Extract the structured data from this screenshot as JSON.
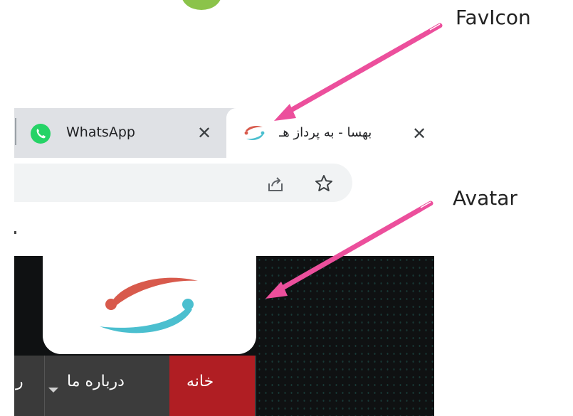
{
  "annotations": {
    "favicon_label": "FavIcon",
    "avatar_label": "Avatar"
  },
  "browser": {
    "tabs": [
      {
        "label": "WhatsApp",
        "close": "✕",
        "icon": "whatsapp-icon"
      },
      {
        "label": "بهسا - به پرداز هـ",
        "close": "✕",
        "icon": "favicon",
        "active": true
      }
    ],
    "toolbar_icons": [
      "share-icon",
      "star-icon"
    ]
  },
  "site": {
    "nav": {
      "home": "خانه",
      "about": "درباره ما",
      "partial": "ر"
    }
  },
  "colors": {
    "arrow": "#ec4f9c",
    "logo_red": "#d85a4c",
    "logo_teal": "#4bbfcf",
    "nav_active": "#b01e23",
    "whatsapp": "#25d366"
  }
}
